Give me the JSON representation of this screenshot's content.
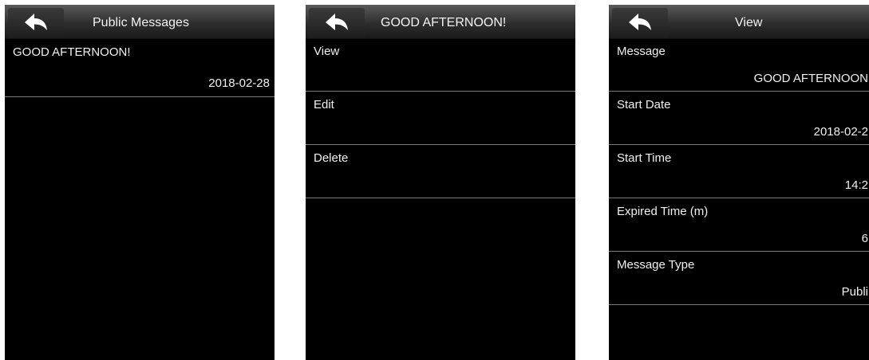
{
  "screens": {
    "messages_list": {
      "title": "Public Messages",
      "items": [
        {
          "text": "GOOD AFTERNOON!",
          "date": "2018-02-28"
        }
      ]
    },
    "message_menu": {
      "title": "GOOD AFTERNOON!",
      "items": [
        "View",
        "Edit",
        "Delete"
      ]
    },
    "view": {
      "title": "View",
      "fields": [
        {
          "label": "Message",
          "value": "GOOD AFTERNOON"
        },
        {
          "label": "Start Date",
          "value": "2018-02-2"
        },
        {
          "label": "Start Time",
          "value": "14:2"
        },
        {
          "label": "Expired Time (m)",
          "value": "6"
        },
        {
          "label": "Message Type",
          "value": "Publi"
        }
      ]
    }
  }
}
